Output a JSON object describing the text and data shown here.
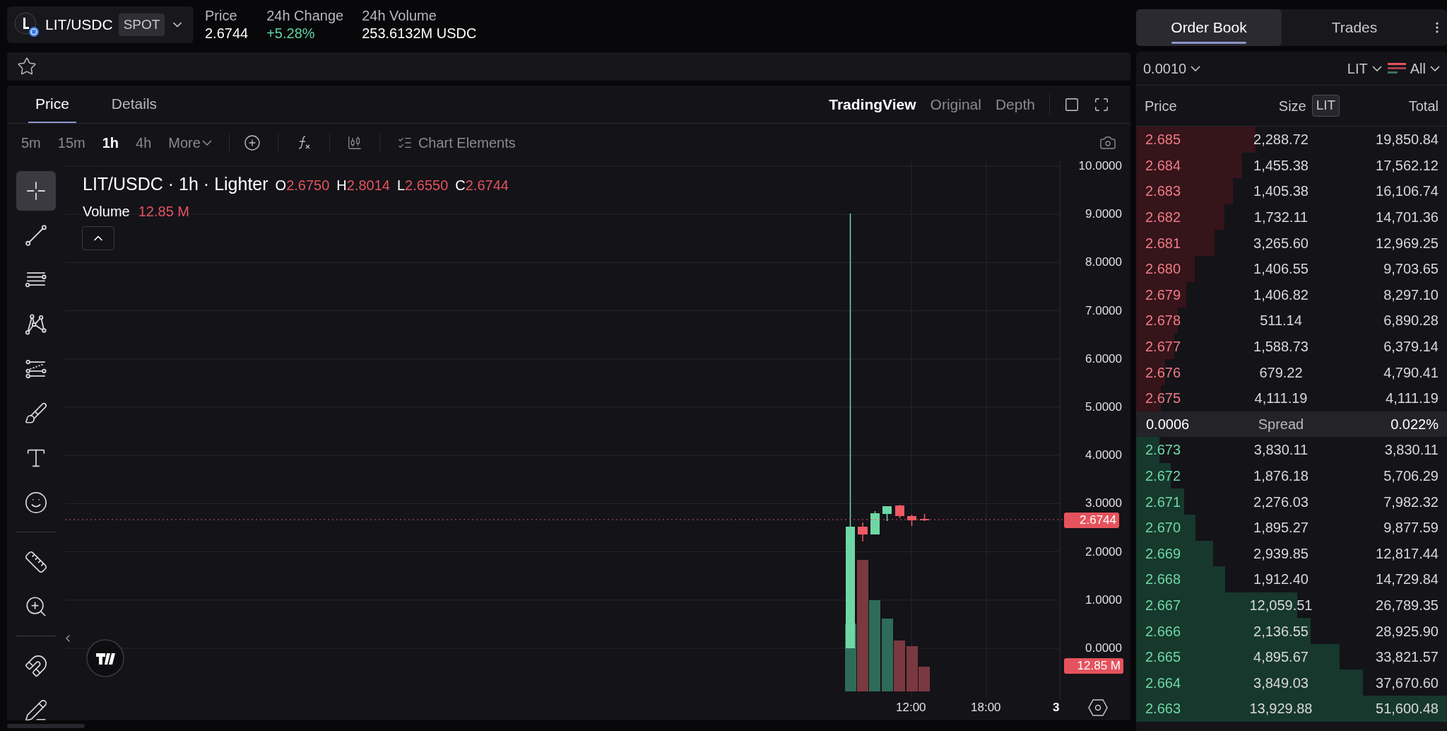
{
  "pair": {
    "symbol": "LIT/USDC",
    "market": "SPOT"
  },
  "stats": [
    {
      "label": "Price",
      "value": "2.6744",
      "color": "#ffffff"
    },
    {
      "label": "24h Change",
      "value": "+5.28%",
      "color": "#5fd3a0"
    },
    {
      "label": "24h Volume",
      "value": "253.6132M USDC",
      "color": "#ffffff"
    }
  ],
  "favorite": {
    "starred": false
  },
  "chart_tabs": [
    {
      "label": "Price",
      "selected": true
    },
    {
      "label": "Details",
      "selected": false
    }
  ],
  "chart_views": [
    {
      "label": "TradingView",
      "selected": true
    },
    {
      "label": "Original",
      "selected": false
    },
    {
      "label": "Depth",
      "selected": false
    }
  ],
  "intervals": [
    {
      "label": "5m",
      "selected": false
    },
    {
      "label": "15m",
      "selected": false
    },
    {
      "label": "1h",
      "selected": true
    },
    {
      "label": "4h",
      "selected": false
    }
  ],
  "more_label": "More",
  "chart_elements_label": "Chart Elements",
  "tools": [
    {
      "kind": "crosshair",
      "selected": true
    },
    {
      "kind": "trend-line",
      "selected": false
    },
    {
      "kind": "horizontal-lines",
      "selected": false
    },
    {
      "kind": "pattern",
      "selected": false
    },
    {
      "kind": "fib",
      "selected": false
    },
    {
      "kind": "brush",
      "selected": false
    },
    {
      "kind": "text",
      "selected": false
    },
    {
      "kind": "emoji",
      "selected": false
    },
    {
      "kind": "divider"
    },
    {
      "kind": "ruler",
      "selected": false
    },
    {
      "kind": "zoom",
      "selected": false
    },
    {
      "kind": "divider"
    },
    {
      "kind": "magnet",
      "selected": false
    },
    {
      "kind": "lock-draw",
      "selected": false
    }
  ],
  "legend": {
    "title": "LIT/USDC · 1h · Lighter",
    "ohlc": [
      {
        "key": "O",
        "value": "2.6750"
      },
      {
        "key": "H",
        "value": "2.8014"
      },
      {
        "key": "L",
        "value": "2.6550"
      },
      {
        "key": "C",
        "value": "2.6744"
      }
    ],
    "volume_label": "Volume",
    "volume_value": "12.85 M"
  },
  "price_axis": [
    "10.0000",
    "9.0000",
    "8.0000",
    "7.0000",
    "6.0000",
    "5.0000",
    "4.0000",
    "3.0000",
    "2.0000",
    "1.0000",
    "0.0000"
  ],
  "last_price_tag": "2.6744",
  "volume_tag": "12.85 M",
  "time_axis": [
    "12:00",
    "18:00",
    "3"
  ],
  "order_book": {
    "tabs": [
      {
        "label": "Order Book",
        "selected": true
      },
      {
        "label": "Trades",
        "selected": false
      }
    ],
    "tick_size": "0.0010",
    "unit": "LIT",
    "side_filter": "All",
    "columns": {
      "price": "Price",
      "size": "Size",
      "size_unit": "LIT",
      "total": "Total"
    },
    "asks": [
      {
        "price": "2.685",
        "size": "2,288.72",
        "total": "19,850.84"
      },
      {
        "price": "2.684",
        "size": "1,455.38",
        "total": "17,562.12"
      },
      {
        "price": "2.683",
        "size": "1,405.38",
        "total": "16,106.74"
      },
      {
        "price": "2.682",
        "size": "1,732.11",
        "total": "14,701.36"
      },
      {
        "price": "2.681",
        "size": "3,265.60",
        "total": "12,969.25"
      },
      {
        "price": "2.680",
        "size": "1,406.55",
        "total": "9,703.65"
      },
      {
        "price": "2.679",
        "size": "1,406.82",
        "total": "8,297.10"
      },
      {
        "price": "2.678",
        "size": "511.14",
        "total": "6,890.28"
      },
      {
        "price": "2.677",
        "size": "1,588.73",
        "total": "6,379.14"
      },
      {
        "price": "2.676",
        "size": "679.22",
        "total": "4,790.41"
      },
      {
        "price": "2.675",
        "size": "4,111.19",
        "total": "4,111.19"
      }
    ],
    "spread": {
      "value": "0.0006",
      "label": "Spread",
      "percent": "0.022%"
    },
    "bids": [
      {
        "price": "2.673",
        "size": "3,830.11",
        "total": "3,830.11"
      },
      {
        "price": "2.672",
        "size": "1,876.18",
        "total": "5,706.29"
      },
      {
        "price": "2.671",
        "size": "2,276.03",
        "total": "7,982.32"
      },
      {
        "price": "2.670",
        "size": "1,895.27",
        "total": "9,877.59"
      },
      {
        "price": "2.669",
        "size": "2,939.85",
        "total": "12,817.44"
      },
      {
        "price": "2.668",
        "size": "1,912.40",
        "total": "14,729.84"
      },
      {
        "price": "2.667",
        "size": "12,059.51",
        "total": "26,789.35"
      },
      {
        "price": "2.666",
        "size": "2,136.55",
        "total": "28,925.90"
      },
      {
        "price": "2.665",
        "size": "4,895.67",
        "total": "33,821.57"
      },
      {
        "price": "2.664",
        "size": "3,849.03",
        "total": "37,670.60"
      },
      {
        "price": "2.663",
        "size": "13,929.88",
        "total": "51,600.48"
      }
    ]
  }
}
